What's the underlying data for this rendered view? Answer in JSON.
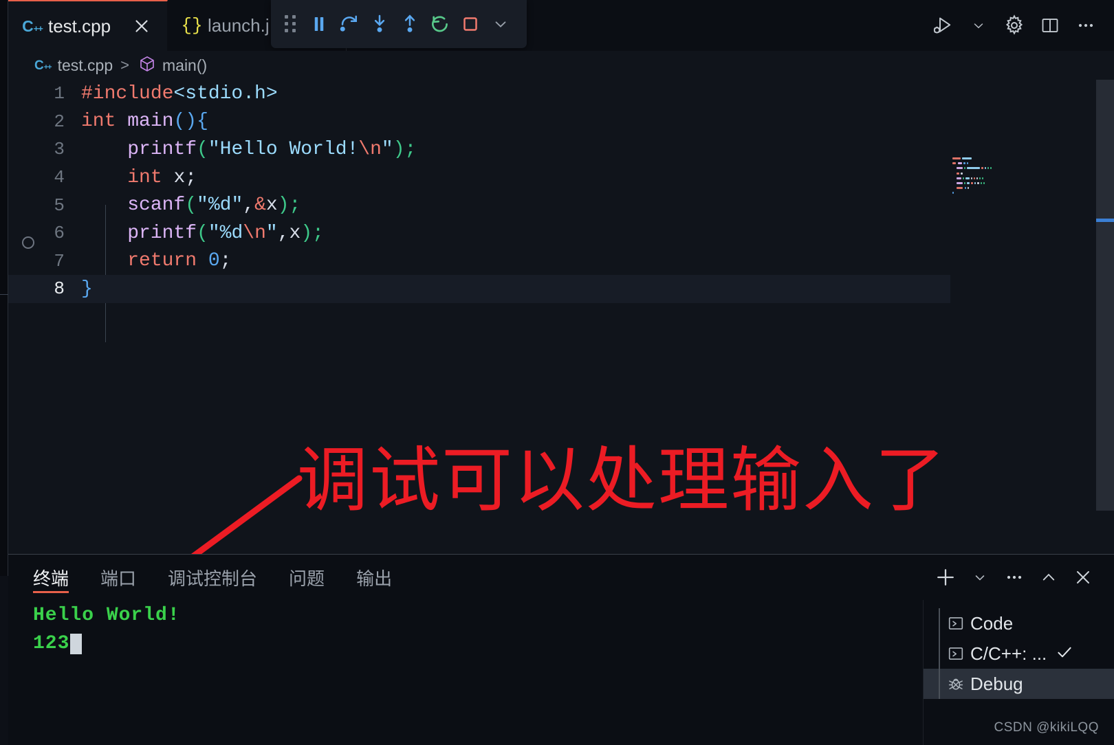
{
  "window": {
    "watermark": "CSDN @kikiLQQ"
  },
  "tabs": [
    {
      "label": "test.cpp",
      "icon": "cpp-file-icon",
      "active": true,
      "closable": true
    },
    {
      "label": "launch.j",
      "icon": "json-file-icon",
      "active": false,
      "closable": false
    }
  ],
  "debug_toolbar": {
    "items": [
      {
        "name": "drag-handle",
        "label": "drag-handle-icon"
      },
      {
        "name": "pause",
        "label": "pause-icon",
        "color": "#5aa8f0"
      },
      {
        "name": "step-over",
        "label": "step-over-icon",
        "color": "#5aa8f0"
      },
      {
        "name": "step-into",
        "label": "step-into-icon",
        "color": "#5aa8f0"
      },
      {
        "name": "step-out",
        "label": "step-out-icon",
        "color": "#5aa8f0"
      },
      {
        "name": "restart",
        "label": "restart-icon",
        "color": "#58c98a"
      },
      {
        "name": "stop",
        "label": "stop-icon",
        "color": "#f07a6e"
      },
      {
        "name": "more",
        "label": "chevron-down-icon",
        "color": "#9aa1ab"
      }
    ]
  },
  "editor_actions": [
    {
      "name": "run-and-debug",
      "icon": "run-debug-icon"
    },
    {
      "name": "run-debug-dropdown",
      "icon": "chevron-down-icon"
    },
    {
      "name": "settings",
      "icon": "gear-icon"
    },
    {
      "name": "split-editor",
      "icon": "split-editor-icon"
    },
    {
      "name": "more-actions",
      "icon": "ellipsis-icon"
    }
  ],
  "breadcrumb": {
    "file": "test.cpp",
    "separator": ">",
    "symbol": "main()"
  },
  "editor": {
    "language": "cpp",
    "active_line": 8,
    "breakpoint_hover_line": 6,
    "lines": [
      {
        "n": "1",
        "tokens": [
          {
            "t": "#include",
            "c": "t-pre"
          },
          {
            "t": "<stdio.h>",
            "c": "t-inc"
          }
        ]
      },
      {
        "n": "2",
        "tokens": [
          {
            "t": "int",
            "c": "t-key"
          },
          {
            "t": " ",
            "c": "t-plain"
          },
          {
            "t": "main",
            "c": "t-fn"
          },
          {
            "t": "()",
            "c": "t-brace"
          },
          {
            "t": "{",
            "c": "t-brace"
          }
        ]
      },
      {
        "n": "3",
        "tokens": [
          {
            "t": "    ",
            "c": "t-plain"
          },
          {
            "t": "printf",
            "c": "t-fn"
          },
          {
            "t": "(",
            "c": "t-paren"
          },
          {
            "t": "\"Hello World!",
            "c": "t-str"
          },
          {
            "t": "\\n",
            "c": "t-esc"
          },
          {
            "t": "\"",
            "c": "t-str"
          },
          {
            "t": ")",
            "c": "t-paren"
          },
          {
            "t": ";",
            "c": "t-paren"
          }
        ]
      },
      {
        "n": "4",
        "tokens": [
          {
            "t": "    ",
            "c": "t-plain"
          },
          {
            "t": "int",
            "c": "t-key"
          },
          {
            "t": " x;",
            "c": "t-plain"
          }
        ]
      },
      {
        "n": "5",
        "tokens": [
          {
            "t": "    ",
            "c": "t-plain"
          },
          {
            "t": "scanf",
            "c": "t-fn"
          },
          {
            "t": "(",
            "c": "t-paren"
          },
          {
            "t": "\"%d\"",
            "c": "t-str"
          },
          {
            "t": ",",
            "c": "t-plain"
          },
          {
            "t": "&",
            "c": "t-amp"
          },
          {
            "t": "x",
            "c": "t-plain"
          },
          {
            "t": ")",
            "c": "t-paren"
          },
          {
            "t": ";",
            "c": "t-paren"
          }
        ]
      },
      {
        "n": "6",
        "tokens": [
          {
            "t": "    ",
            "c": "t-plain"
          },
          {
            "t": "printf",
            "c": "t-fn"
          },
          {
            "t": "(",
            "c": "t-paren"
          },
          {
            "t": "\"%d",
            "c": "t-str"
          },
          {
            "t": "\\n",
            "c": "t-esc"
          },
          {
            "t": "\"",
            "c": "t-str"
          },
          {
            "t": ",x",
            "c": "t-plain"
          },
          {
            "t": ")",
            "c": "t-paren"
          },
          {
            "t": ";",
            "c": "t-paren"
          }
        ]
      },
      {
        "n": "7",
        "tokens": [
          {
            "t": "    ",
            "c": "t-plain"
          },
          {
            "t": "return",
            "c": "t-key"
          },
          {
            "t": " ",
            "c": "t-plain"
          },
          {
            "t": "0",
            "c": "t-num"
          },
          {
            "t": ";",
            "c": "t-plain"
          }
        ]
      },
      {
        "n": "8",
        "tokens": [
          {
            "t": "}",
            "c": "t-brace"
          }
        ]
      }
    ]
  },
  "annotation": {
    "text": "调试可以处理输入了",
    "color": "#ec1c24"
  },
  "panel": {
    "tabs": [
      {
        "label": "终端",
        "active": true
      },
      {
        "label": "端口",
        "active": false
      },
      {
        "label": "调试控制台",
        "active": false
      },
      {
        "label": "问题",
        "active": false
      },
      {
        "label": "输出",
        "active": false
      }
    ],
    "actions": [
      {
        "name": "new-terminal",
        "icon": "plus-icon"
      },
      {
        "name": "new-terminal-dropdown",
        "icon": "chevron-down-icon"
      },
      {
        "name": "panel-more",
        "icon": "ellipsis-icon"
      },
      {
        "name": "maximize-panel",
        "icon": "chevron-up-icon"
      },
      {
        "name": "close-panel",
        "icon": "close-icon"
      }
    ],
    "terminal_output": [
      {
        "text": "Hello World!",
        "cursor": false
      },
      {
        "text": "123",
        "cursor": true
      }
    ],
    "terminal_list": [
      {
        "label": "Code",
        "icon": "terminal-icon",
        "selected": false,
        "checked": false
      },
      {
        "label": "C/C++: ...",
        "icon": "terminal-icon",
        "selected": false,
        "checked": true
      },
      {
        "label": "Debug",
        "icon": "bug-icon",
        "selected": true,
        "checked": false
      }
    ]
  },
  "colors": {
    "editor_bg": "#10141b",
    "panel_bg": "#0b0e14",
    "accent": "#e8604a",
    "terminal_green": "#3ad14b",
    "annotation_red": "#ec1c24",
    "cursor_marker_blue": "#3b7fd4"
  }
}
